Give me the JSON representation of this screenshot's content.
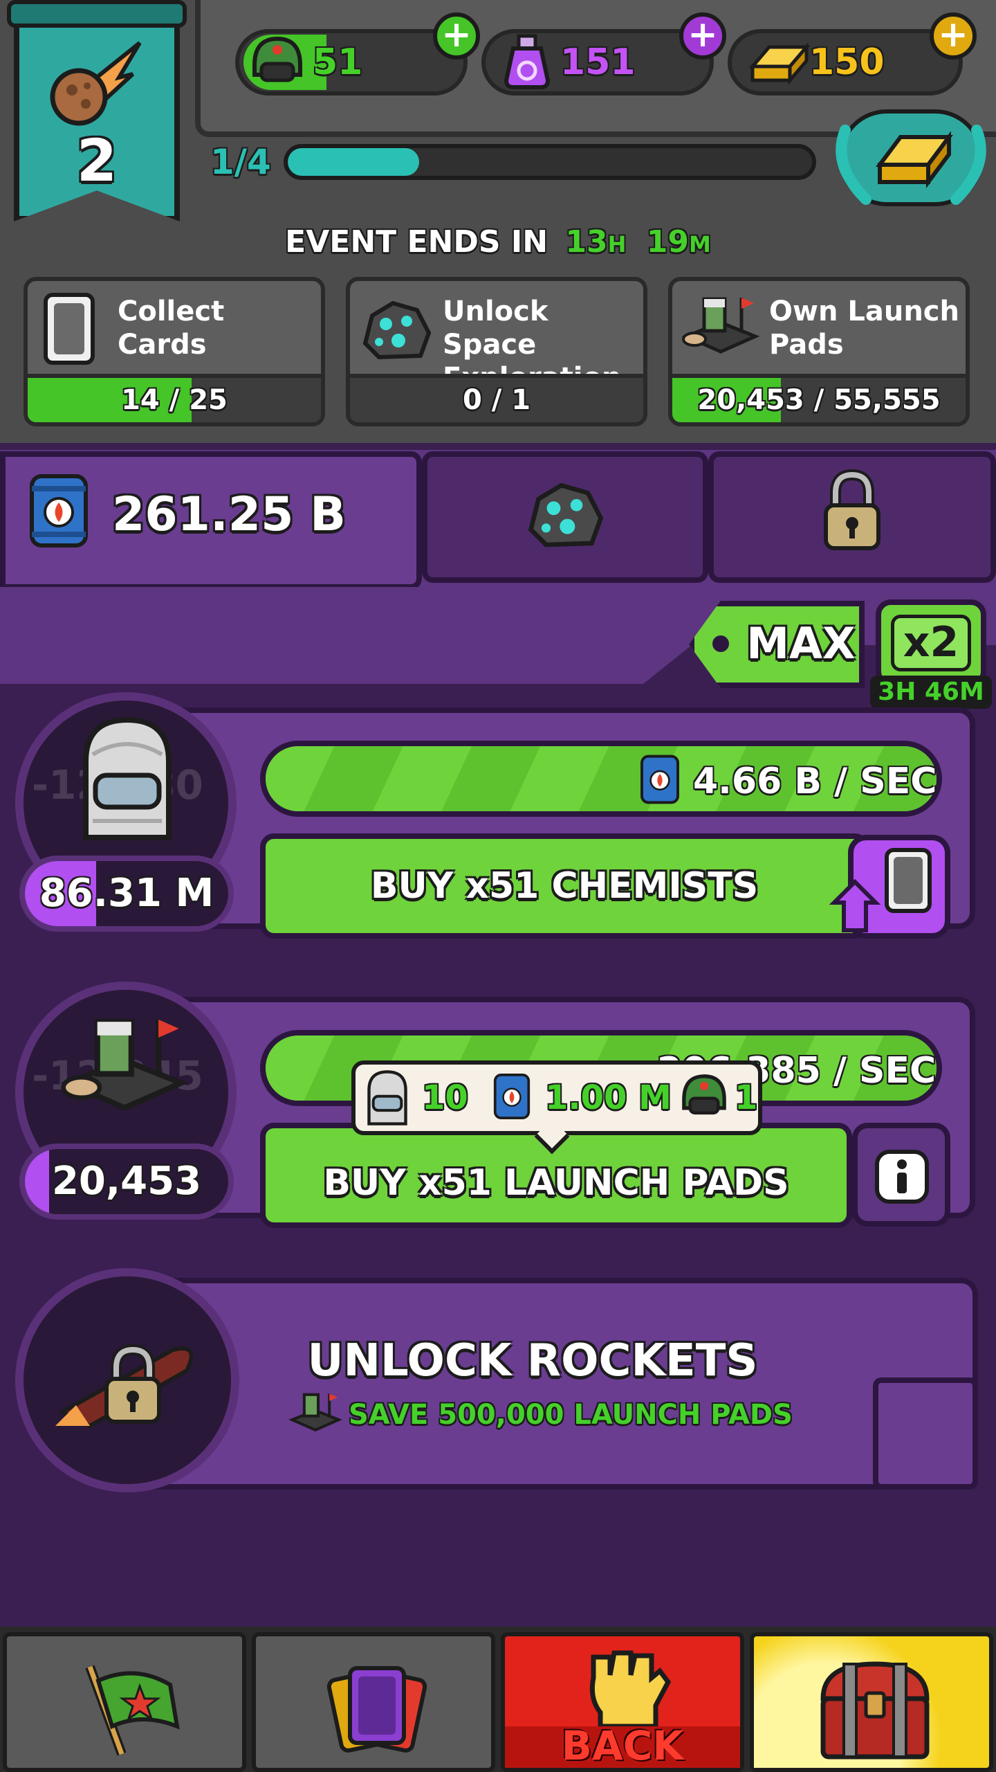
{
  "header": {
    "level": "2",
    "currencies": [
      {
        "icon": "soldier-helmet-icon",
        "value": "51",
        "color": "#45d12a",
        "plus_color": "#45c528"
      },
      {
        "icon": "potion-icon",
        "value": "151",
        "color": "#c453f5",
        "plus_color": "#a23bd6"
      },
      {
        "icon": "gold-bar-icon",
        "value": "150",
        "color": "#f7c21b",
        "plus_color": "#e0a90f"
      }
    ],
    "plus_symbol": "+",
    "progress_label": "1/4",
    "progress_fraction": 0.25,
    "event_prefix": "EVENT ENDS IN",
    "event_hours": "13",
    "event_hours_unit": "H",
    "event_minutes": "19",
    "event_minutes_unit": "M"
  },
  "quests": [
    {
      "icon": "card-icon",
      "title": "Collect Cards",
      "progress": "14 / 25",
      "fraction": 0.56
    },
    {
      "icon": "space-rock-icon",
      "title": "Unlock Space Exploration",
      "progress": "0 / 1",
      "fraction": 0.0
    },
    {
      "icon": "launch-pad-icon",
      "title": "Own Launch Pads",
      "progress": "20,453 / 55,555",
      "fraction": 0.37
    }
  ],
  "resource": {
    "icon": "fuel-barrel-icon",
    "value": "261.25 B"
  },
  "tabs": [
    {
      "icon": "space-rock-icon"
    },
    {
      "icon": "lock-icon"
    }
  ],
  "buy_mode": {
    "label": "MAX",
    "boost_label": "x2",
    "boost_timer": "3H 46M"
  },
  "units": [
    {
      "name": "chemists",
      "icon": "chemist-helmet-icon",
      "faded_label": "-12,380",
      "count": "86.31 M",
      "count_fraction": 0.35,
      "rate": "4.66 B / SEC",
      "buy_label": "BUY x51 CHEMISTS",
      "side_icon": "card-upgrade-icon"
    },
    {
      "name": "launch-pads",
      "icon": "launch-pad-icon",
      "faded_label": "-12,345",
      "count": "20,453",
      "count_fraction": 0.12,
      "rate": "206,385 / SEC",
      "buy_label": "BUY x51 LAUNCH PADS",
      "side_icon": "info-icon",
      "cost": [
        {
          "icon": "chemist-helmet-icon",
          "value": "10"
        },
        {
          "icon": "fuel-barrel-icon",
          "value": "1.00 M"
        },
        {
          "icon": "soldier-helmet-icon",
          "value": "1"
        }
      ]
    }
  ],
  "locked": {
    "title": "UNLOCK ROCKETS",
    "requirement": "SAVE 500,000 LAUNCH PADS",
    "icon": "rocket-lock-icon"
  },
  "nav": [
    {
      "name": "flag",
      "icon": "flag-icon",
      "color": "#5a5a5a"
    },
    {
      "name": "cards",
      "icon": "cards-icon",
      "color": "#5a5a5a"
    },
    {
      "name": "back",
      "icon": "fist-icon",
      "label": "BACK",
      "color": "#e2231c"
    },
    {
      "name": "chest",
      "icon": "chest-icon",
      "color": "#f5d21b"
    }
  ],
  "colors": {
    "accent_green": "#45d12a",
    "purple": "#b14ff0",
    "teal": "#2bc0b4"
  }
}
